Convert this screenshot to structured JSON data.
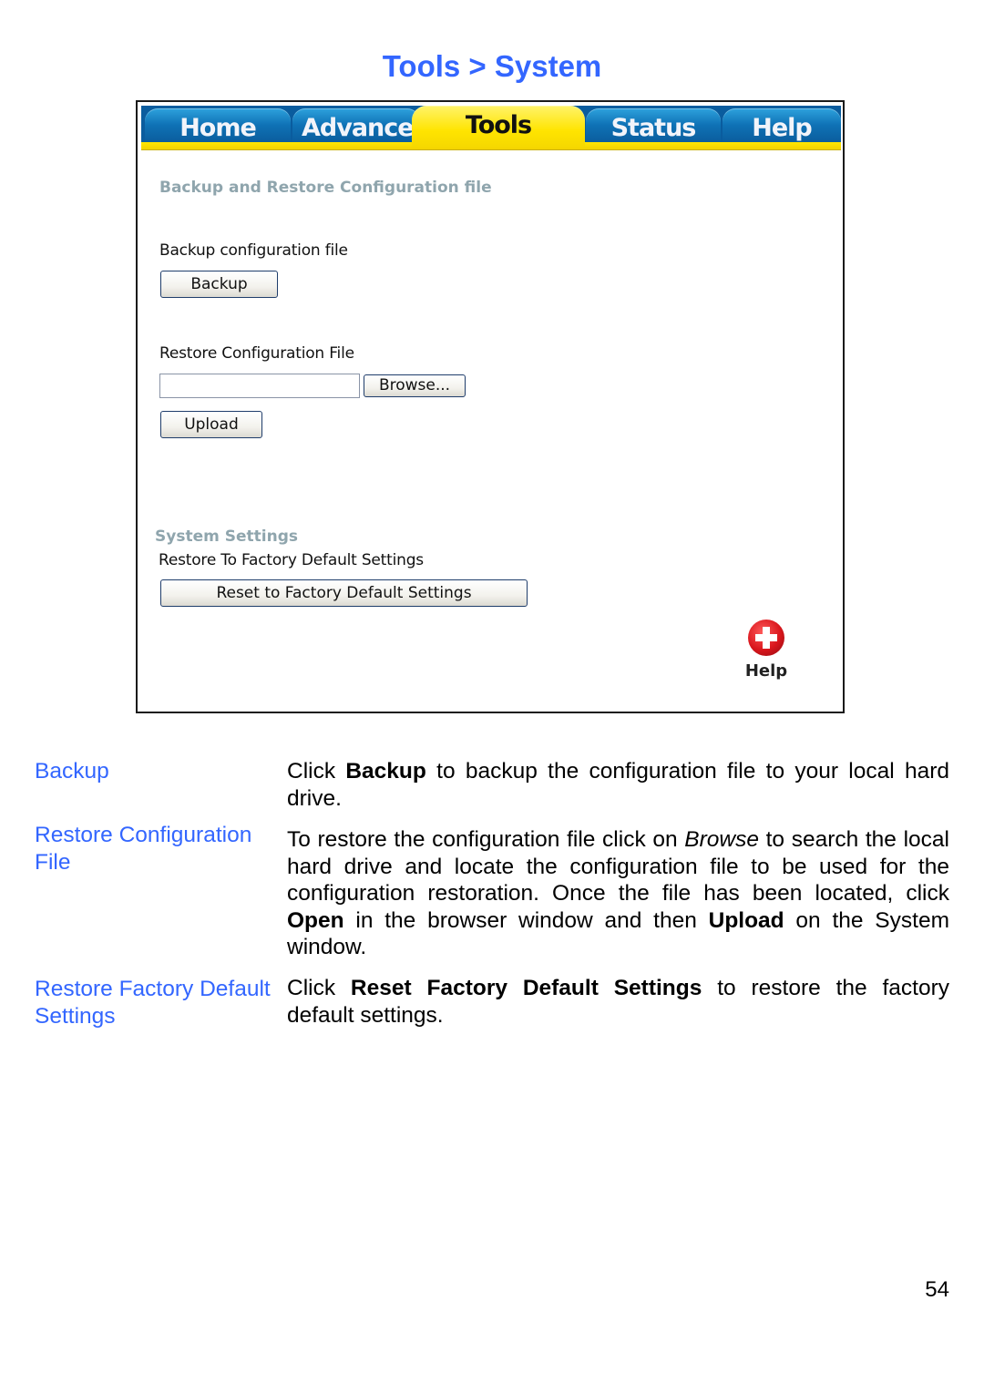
{
  "page": {
    "title": "Tools > System",
    "page_number": "54"
  },
  "router_ui": {
    "tabs": [
      {
        "label": "Home",
        "active": false
      },
      {
        "label": "Advanced",
        "active": false
      },
      {
        "label": "Tools",
        "active": true
      },
      {
        "label": "Status",
        "active": false
      },
      {
        "label": "Help",
        "active": false
      }
    ],
    "backup_section": {
      "heading": "Backup and Restore Configuration file",
      "backup_label": "Backup configuration file",
      "backup_button": "Backup",
      "restore_label": "Restore Configuration File",
      "file_input_value": "",
      "browse_button": "Browse...",
      "upload_button": "Upload"
    },
    "system_section": {
      "heading": "System Settings",
      "factory_label": "Restore To Factory Default Settings",
      "reset_button": "Reset to Factory Default Settings"
    },
    "help": {
      "icon": "red-cross-help-icon",
      "label": "Help"
    },
    "colors": {
      "tab_blue": "#0f72b6",
      "tab_active_yellow": "#ffe400",
      "heading_gray": "#8fa5ad"
    }
  },
  "descriptions": [
    {
      "term": "Backup",
      "segments": [
        {
          "text": "Click ",
          "style": "normal"
        },
        {
          "text": "Backup",
          "style": "bold"
        },
        {
          "text": " to backup the configuration file to your local hard drive.",
          "style": "normal"
        }
      ]
    },
    {
      "term": "Restore Configuration File",
      "segments": [
        {
          "text": "To restore the configuration file click on ",
          "style": "normal"
        },
        {
          "text": "Browse",
          "style": "italic"
        },
        {
          "text": " to search the local hard drive and locate the configuration file to be used for the configuration restoration. Once the file has been located, click ",
          "style": "normal"
        },
        {
          "text": "Open",
          "style": "bold"
        },
        {
          "text": " in the browser window and then ",
          "style": "normal"
        },
        {
          "text": "Upload",
          "style": "bold"
        },
        {
          "text": " on the System window.",
          "style": "normal"
        }
      ]
    },
    {
      "term": "Restore Factory Default Settings",
      "segments": [
        {
          "text": "Click ",
          "style": "normal"
        },
        {
          "text": "Reset Factory Default Settings",
          "style": "bold"
        },
        {
          "text": " to restore the factory default settings.",
          "style": "normal"
        }
      ]
    }
  ],
  "colors": {
    "title_blue": "#3366ff",
    "term_blue": "#3366ff"
  }
}
